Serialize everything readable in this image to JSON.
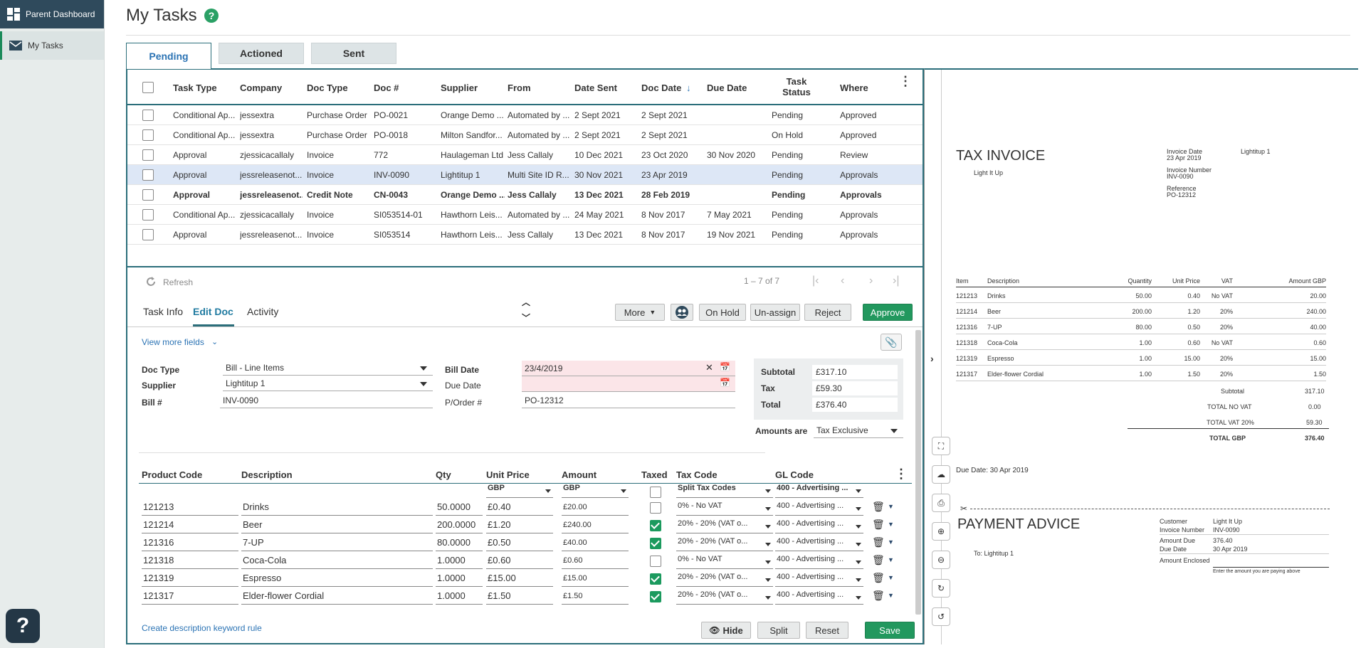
{
  "sidebar": {
    "items": [
      {
        "label": "Parent Dashboard",
        "icon": "dashboard-icon"
      },
      {
        "label": "My Tasks",
        "icon": "mail-icon"
      }
    ],
    "help_label": "?"
  },
  "header": {
    "title": "My Tasks",
    "help_icon": "?"
  },
  "tabs": [
    {
      "label": "Pending",
      "active": true
    },
    {
      "label": "Actioned"
    },
    {
      "label": "Sent"
    }
  ],
  "grid": {
    "columns": [
      "Task Type",
      "Company",
      "Doc Type",
      "Doc #",
      "Supplier",
      "From",
      "Date Sent",
      "Doc Date",
      "Due Date",
      "Task Status",
      "Where"
    ],
    "rows": [
      [
        "Conditional Ap...",
        "jessextra",
        "Purchase Order",
        "PO-0021",
        "Orange Demo ...",
        "Automated by ...",
        "2 Sept 2021",
        "2 Sept 2021",
        "",
        "Pending",
        "Approved"
      ],
      [
        "Conditional Ap...",
        "jessextra",
        "Purchase Order",
        "PO-0018",
        "Milton Sandfor...",
        "Automated by ...",
        "2 Sept 2021",
        "2 Sept 2021",
        "",
        "On Hold",
        "Approved"
      ],
      [
        "Approval",
        "zjessicacallaly",
        "Invoice",
        "772",
        "Haulageman Ltd",
        "Jess Callaly",
        "10 Dec 2021",
        "23 Oct 2020",
        "30 Nov 2020",
        "Pending",
        "Review"
      ],
      [
        "Approval",
        "jessreleasenot...",
        "Invoice",
        "INV-0090",
        "Lightitup 1",
        "Multi Site ID R...",
        "30 Nov 2021",
        "23 Apr 2019",
        "",
        "Pending",
        "Approvals"
      ],
      [
        "Approval",
        "jessreleasenot...",
        "Credit Note",
        "CN-0043",
        "Orange Demo ...",
        "Jess Callaly",
        "13 Dec 2021",
        "28 Feb 2019",
        "",
        "Pending",
        "Approvals"
      ],
      [
        "Conditional Ap...",
        "zjessicacallaly",
        "Invoice",
        "SI053514-01",
        "Hawthorn Leis...",
        "Automated by ...",
        "24 May 2021",
        "8 Nov 2017",
        "7 May 2021",
        "Pending",
        "Approvals"
      ],
      [
        "Approval",
        "jessreleasenot...",
        "Invoice",
        "SI053514",
        "Hawthorn Leis...",
        "Jess Callaly",
        "13 Dec 2021",
        "8 Nov 2017",
        "19 Nov 2021",
        "Pending",
        "Approvals"
      ]
    ],
    "refresh_label": "Refresh",
    "pager": "1 – 7 of 7"
  },
  "detail": {
    "tabs": [
      "Task Info",
      "Edit Doc",
      "Activity"
    ],
    "actions": {
      "more": "More",
      "on_hold": "On Hold",
      "unassign": "Un-assign",
      "reject": "Reject",
      "approve": "Approve"
    },
    "view_more": "View more fields",
    "fields": {
      "doc_type_label": "Doc Type",
      "doc_type": "Bill - Line Items",
      "supplier_label": "Supplier",
      "supplier": "Lightitup 1",
      "bill_no_label": "Bill #",
      "bill_no": "INV-0090",
      "bill_date_label": "Bill Date",
      "bill_date": "23/4/2019",
      "due_date_label": "Due Date",
      "due_date": "",
      "porder_label": "P/Order #",
      "porder": "PO-12312"
    },
    "totals": {
      "subtotal_label": "Subtotal",
      "subtotal": "£317.10",
      "tax_label": "Tax",
      "tax": "£59.30",
      "total_label": "Total",
      "total": "£376.40"
    },
    "amounts_are_label": "Amounts are",
    "amounts_are": "Tax Exclusive",
    "lines": {
      "headers": {
        "code": "Product Code",
        "desc": "Description",
        "qty": "Qty",
        "unit": "Unit Price",
        "amount": "Amount",
        "taxed": "Taxed",
        "taxcode": "Tax Code",
        "gl": "GL Code"
      },
      "sub": {
        "unit_cur": "GBP",
        "amount_cur": "GBP",
        "taxcode": "Split Tax Codes",
        "gl": "400 - Advertising ..."
      },
      "items": [
        {
          "code": "121213",
          "desc": "Drinks",
          "qty": "50.0000",
          "unit": "£0.40",
          "amount": "£20.00",
          "taxed": false,
          "taxcode": "0% - No VAT",
          "gl": "400 - Advertising ..."
        },
        {
          "code": "121214",
          "desc": "Beer",
          "qty": "200.0000",
          "unit": "£1.20",
          "amount": "£240.00",
          "taxed": true,
          "taxcode": "20% - 20% (VAT o...",
          "gl": "400 - Advertising ..."
        },
        {
          "code": "121316",
          "desc": "7-UP",
          "qty": "80.0000",
          "unit": "£0.50",
          "amount": "£40.00",
          "taxed": true,
          "taxcode": "20% - 20% (VAT o...",
          "gl": "400 - Advertising ..."
        },
        {
          "code": "121318",
          "desc": "Coca-Cola",
          "qty": "1.0000",
          "unit": "£0.60",
          "amount": "£0.60",
          "taxed": false,
          "taxcode": "0% - No VAT",
          "gl": "400 - Advertising ..."
        },
        {
          "code": "121319",
          "desc": "Espresso",
          "qty": "1.0000",
          "unit": "£15.00",
          "amount": "£15.00",
          "taxed": true,
          "taxcode": "20% - 20% (VAT o...",
          "gl": "400 - Advertising ..."
        },
        {
          "code": "121317",
          "desc": "Elder-flower Cordial",
          "qty": "1.0000",
          "unit": "£1.50",
          "amount": "£1.50",
          "taxed": true,
          "taxcode": "20% - 20% (VAT o...",
          "gl": "400 - Advertising ..."
        }
      ]
    },
    "keyword_rule": "Create description keyword rule",
    "buttons": {
      "hide": "Hide",
      "split": "Split",
      "reset": "Reset",
      "save": "Save"
    }
  },
  "preview": {
    "title": "TAX INVOICE",
    "from": "Light It Up",
    "invoice_date_label": "Invoice Date",
    "invoice_date": "23 Apr 2019",
    "invoice_number_label": "Invoice Number",
    "invoice_number": "INV-0090",
    "reference_label": "Reference",
    "reference": "PO-12312",
    "supplier": "Lightitup 1",
    "table_headers": [
      "Item",
      "Description",
      "Quantity",
      "Unit Price",
      "VAT",
      "Amount GBP"
    ],
    "table_rows": [
      [
        "121213",
        "Drinks",
        "50.00",
        "0.40",
        "No VAT",
        "20.00"
      ],
      [
        "121214",
        "Beer",
        "200.00",
        "1.20",
        "20%",
        "240.00"
      ],
      [
        "121316",
        "7-UP",
        "80.00",
        "0.50",
        "20%",
        "40.00"
      ],
      [
        "121318",
        "Coca-Cola",
        "1.00",
        "0.60",
        "No VAT",
        "0.60"
      ],
      [
        "121319",
        "Espresso",
        "1.00",
        "15.00",
        "20%",
        "15.00"
      ],
      [
        "121317",
        "Elder-flower Cordial",
        "1.00",
        "1.50",
        "20%",
        "1.50"
      ]
    ],
    "subtotal_label": "Subtotal",
    "subtotal": "317.10",
    "novat_label": "TOTAL  NO VAT",
    "novat": "0.00",
    "vat_label": "TOTAL  VAT 20%",
    "vat": "59.30",
    "total_label": "TOTAL GBP",
    "total": "376.40",
    "due_date": "Due Date: 30 Apr 2019",
    "payment_title": "PAYMENT ADVICE",
    "to": "To: Lightitup 1",
    "customer_label": "Customer",
    "customer": "Light It Up",
    "pa_invoice_label": "Invoice Number",
    "pa_invoice": "INV-0090",
    "amount_due_label": "Amount Due",
    "amount_due": "376.40",
    "pa_due_label": "Due Date",
    "pa_due": "30 Apr 2019",
    "enclosed_label": "Amount Enclosed",
    "enclosed_hint": "Enter the amount you are paying above"
  },
  "colors": {
    "accent": "#2b6e7a",
    "approve": "#22985e",
    "sidebar_dark": "#2f4a5c"
  }
}
